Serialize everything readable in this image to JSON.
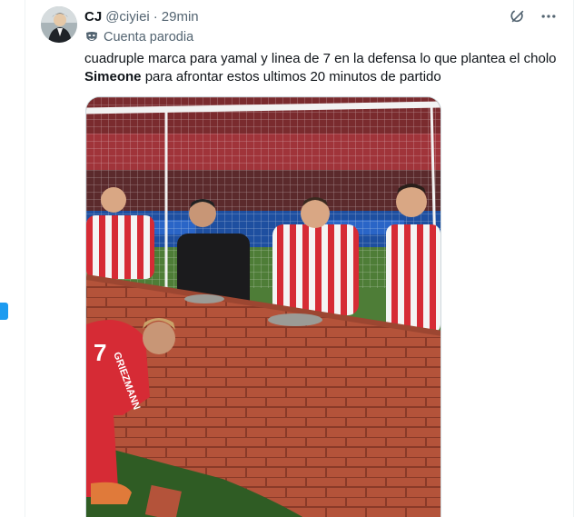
{
  "tweet": {
    "display_name": "CJ",
    "handle": "@ciyiei",
    "separator": "·",
    "time": "29min",
    "label": "Cuenta parodia",
    "text_before": "cuadruple marca para yamal y linea de 7 en la defensa lo que plantea el cholo ",
    "text_bold": "Simeone",
    "text_after": " para afrontar estos ultimos 20 minutos de partido",
    "header_icons": [
      "grok-icon",
      "more-icon"
    ]
  },
  "media": {
    "jersey_numbers": [
      "7"
    ],
    "jersey_name": "GRIEZMANN",
    "description_icons": [
      "atletico-jersey"
    ]
  },
  "colors": {
    "accent": "#1d9bf0",
    "text_primary": "#0f1419",
    "text_secondary": "#536471",
    "border": "#eff3f4"
  }
}
